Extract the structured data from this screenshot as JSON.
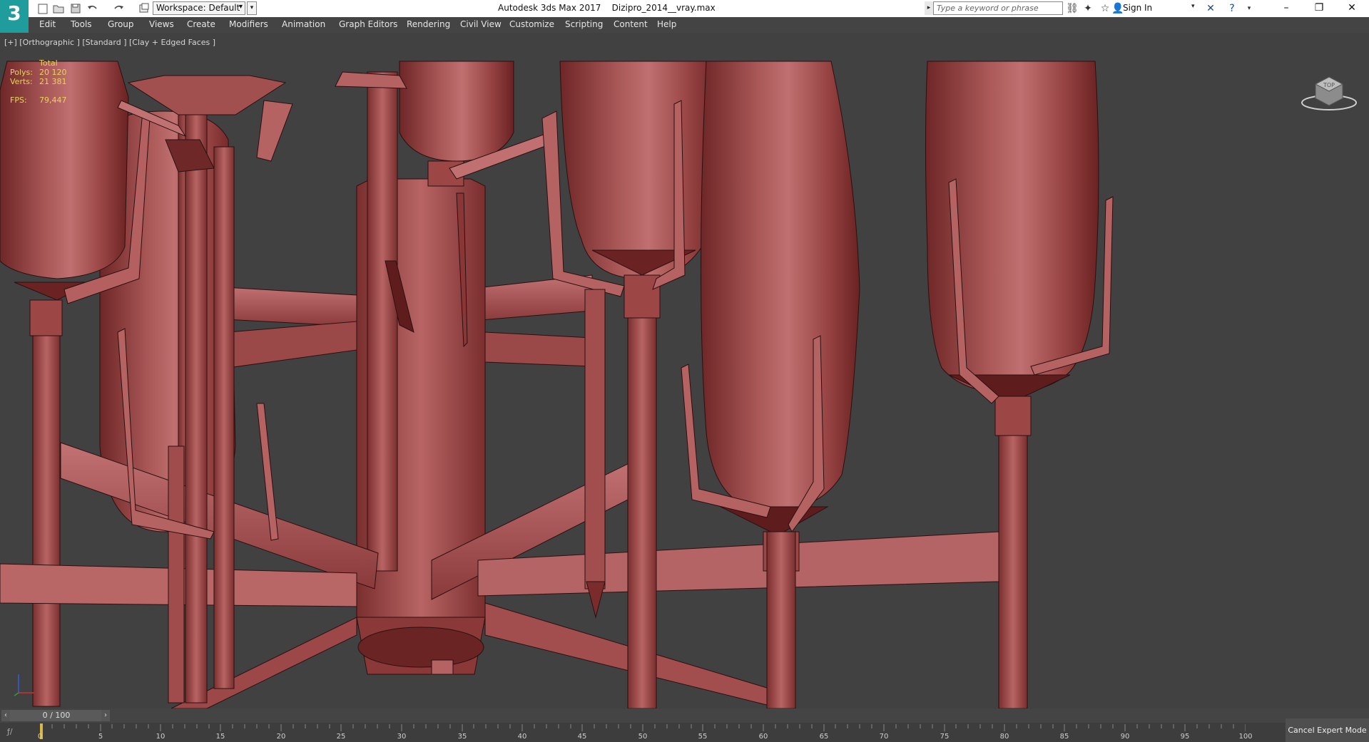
{
  "app": {
    "title": "Autodesk 3ds Max 2017    Dizipro_2014__vray.max",
    "logo_text": "3"
  },
  "toolbar": {
    "workspace_label": "Workspace: Default",
    "search_placeholder": "Type a keyword or phrase",
    "sign_in": "Sign In"
  },
  "menu": [
    "Edit",
    "Tools",
    "Group",
    "Views",
    "Create",
    "Modifiers",
    "Animation",
    "Graph Editors",
    "Rendering",
    "Civil View",
    "Customize",
    "Scripting",
    "Content",
    "Help"
  ],
  "viewport": {
    "label": "[+] [Orthographic ] [Standard ] [Clay + Edged Faces ]",
    "stats": {
      "total_label": "Total",
      "polys_label": "Polys:",
      "polys_value": "20 120",
      "verts_label": "Verts:",
      "verts_value": "21 381",
      "fps_label": "FPS:",
      "fps_value": "79,447"
    },
    "viewcube_label": "TOP"
  },
  "timeline": {
    "frame_display": "0 / 100",
    "tick_labels": [
      "0",
      "5",
      "10",
      "15",
      "20",
      "25",
      "30",
      "35",
      "40",
      "45",
      "50",
      "55",
      "60",
      "65",
      "70",
      "75",
      "80",
      "85",
      "90",
      "95",
      "100"
    ],
    "cancel_expert": "Cancel Expert Mode"
  },
  "colors": {
    "accent": "#1f9c9c",
    "clay": "#9b4a4a",
    "clay_light": "#b86464",
    "clay_dark": "#6e2626",
    "viewport_bg": "#414141",
    "stats_text": "#e8d45a"
  }
}
